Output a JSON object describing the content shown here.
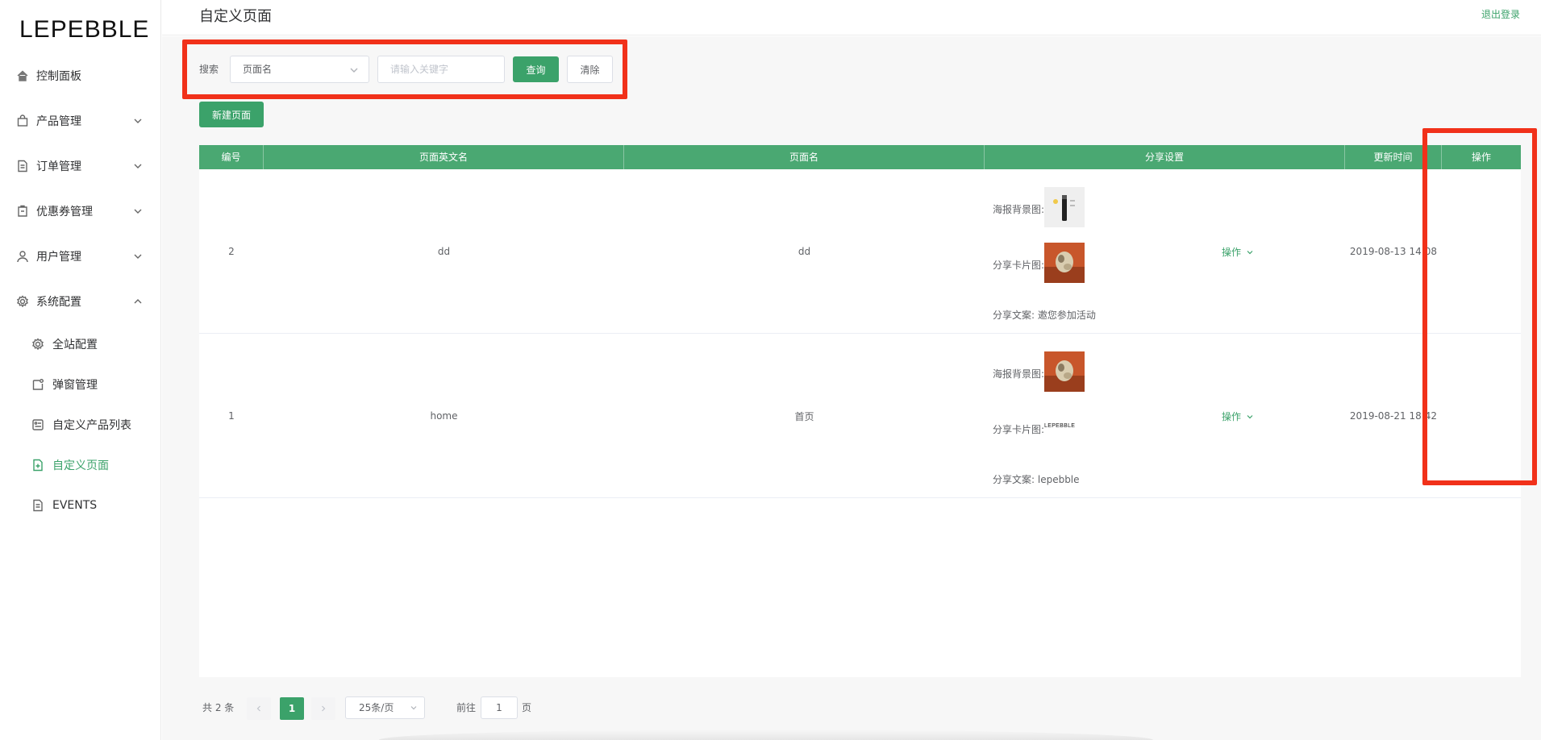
{
  "brand": "LEPEBBLE",
  "header": {
    "title": "自定义页面",
    "logout": "退出登录"
  },
  "sidebar": {
    "items": [
      {
        "label": "控制面板",
        "icon": "home-icon"
      },
      {
        "label": "产品管理",
        "icon": "bag-icon"
      },
      {
        "label": "订单管理",
        "icon": "document-icon"
      },
      {
        "label": "优惠券管理",
        "icon": "coupon-icon"
      },
      {
        "label": "用户管理",
        "icon": "user-icon"
      },
      {
        "label": "系统配置",
        "icon": "gear-icon"
      }
    ],
    "sub_items": [
      {
        "label": "全站配置",
        "icon": "gear-icon"
      },
      {
        "label": "弹窗管理",
        "icon": "popup-icon"
      },
      {
        "label": "自定义产品列表",
        "icon": "list-icon"
      },
      {
        "label": "自定义页面",
        "icon": "page-add-icon",
        "active": true
      },
      {
        "label": "EVENTS",
        "icon": "document-icon"
      }
    ]
  },
  "search": {
    "label": "搜索",
    "select_value": "页面名",
    "placeholder": "请输入关键字",
    "query_btn": "查询",
    "clear_btn": "清除"
  },
  "new_page_btn": "新建页面",
  "table": {
    "columns": [
      "编号",
      "页面英文名",
      "页面名",
      "分享设置",
      "更新时间",
      "操作"
    ],
    "rows": [
      {
        "id": "2",
        "en_name": "dd",
        "name": "dd",
        "poster_label": "海报背景图:",
        "card_label": "分享卡片图:",
        "copy": "分享文案: 邀您参加活动",
        "updated": "2019-08-13 14:08",
        "op": "操作"
      },
      {
        "id": "1",
        "en_name": "home",
        "name": "首页",
        "poster_label": "海报背景图:",
        "card_label": "分享卡片图:",
        "card_logo_text": "LEPEBBLE",
        "copy": "分享文案: lepebble",
        "updated": "2019-08-21 18:42",
        "op": "操作"
      }
    ]
  },
  "pagination": {
    "total": "共 2 条",
    "current": "1",
    "page_size": "25条/页",
    "goto_prefix": "前往",
    "goto_value": "1",
    "goto_suffix": "页"
  },
  "colors": {
    "accent": "#3ba26a",
    "header_bg": "#4aa872",
    "highlight": "#f1311a"
  }
}
